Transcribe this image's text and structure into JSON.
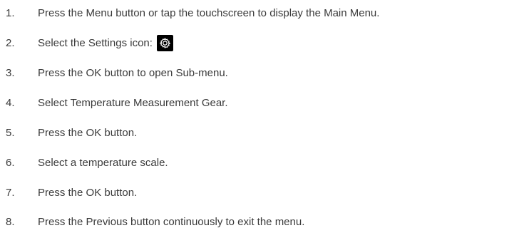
{
  "steps": [
    {
      "number": "1.",
      "text": "Press the Menu button or tap the touchscreen to display the Main Menu."
    },
    {
      "number": "2.",
      "text": "Select the Settings icon:",
      "icon": "settings-icon"
    },
    {
      "number": "3.",
      "text": "Press the OK button to open Sub-menu."
    },
    {
      "number": "4.",
      "text": "Select Temperature Measurement Gear."
    },
    {
      "number": "5.",
      "text": "Press the OK button."
    },
    {
      "number": "6.",
      "text": "Select a temperature scale."
    },
    {
      "number": "7.",
      "text": "Press the OK button."
    },
    {
      "number": "8.",
      "text": "Press the Previous button continuously to exit the menu."
    }
  ],
  "colors": {
    "text": "#3a3a3a",
    "icon_bg": "#000000",
    "icon_fg": "#ffffff"
  }
}
